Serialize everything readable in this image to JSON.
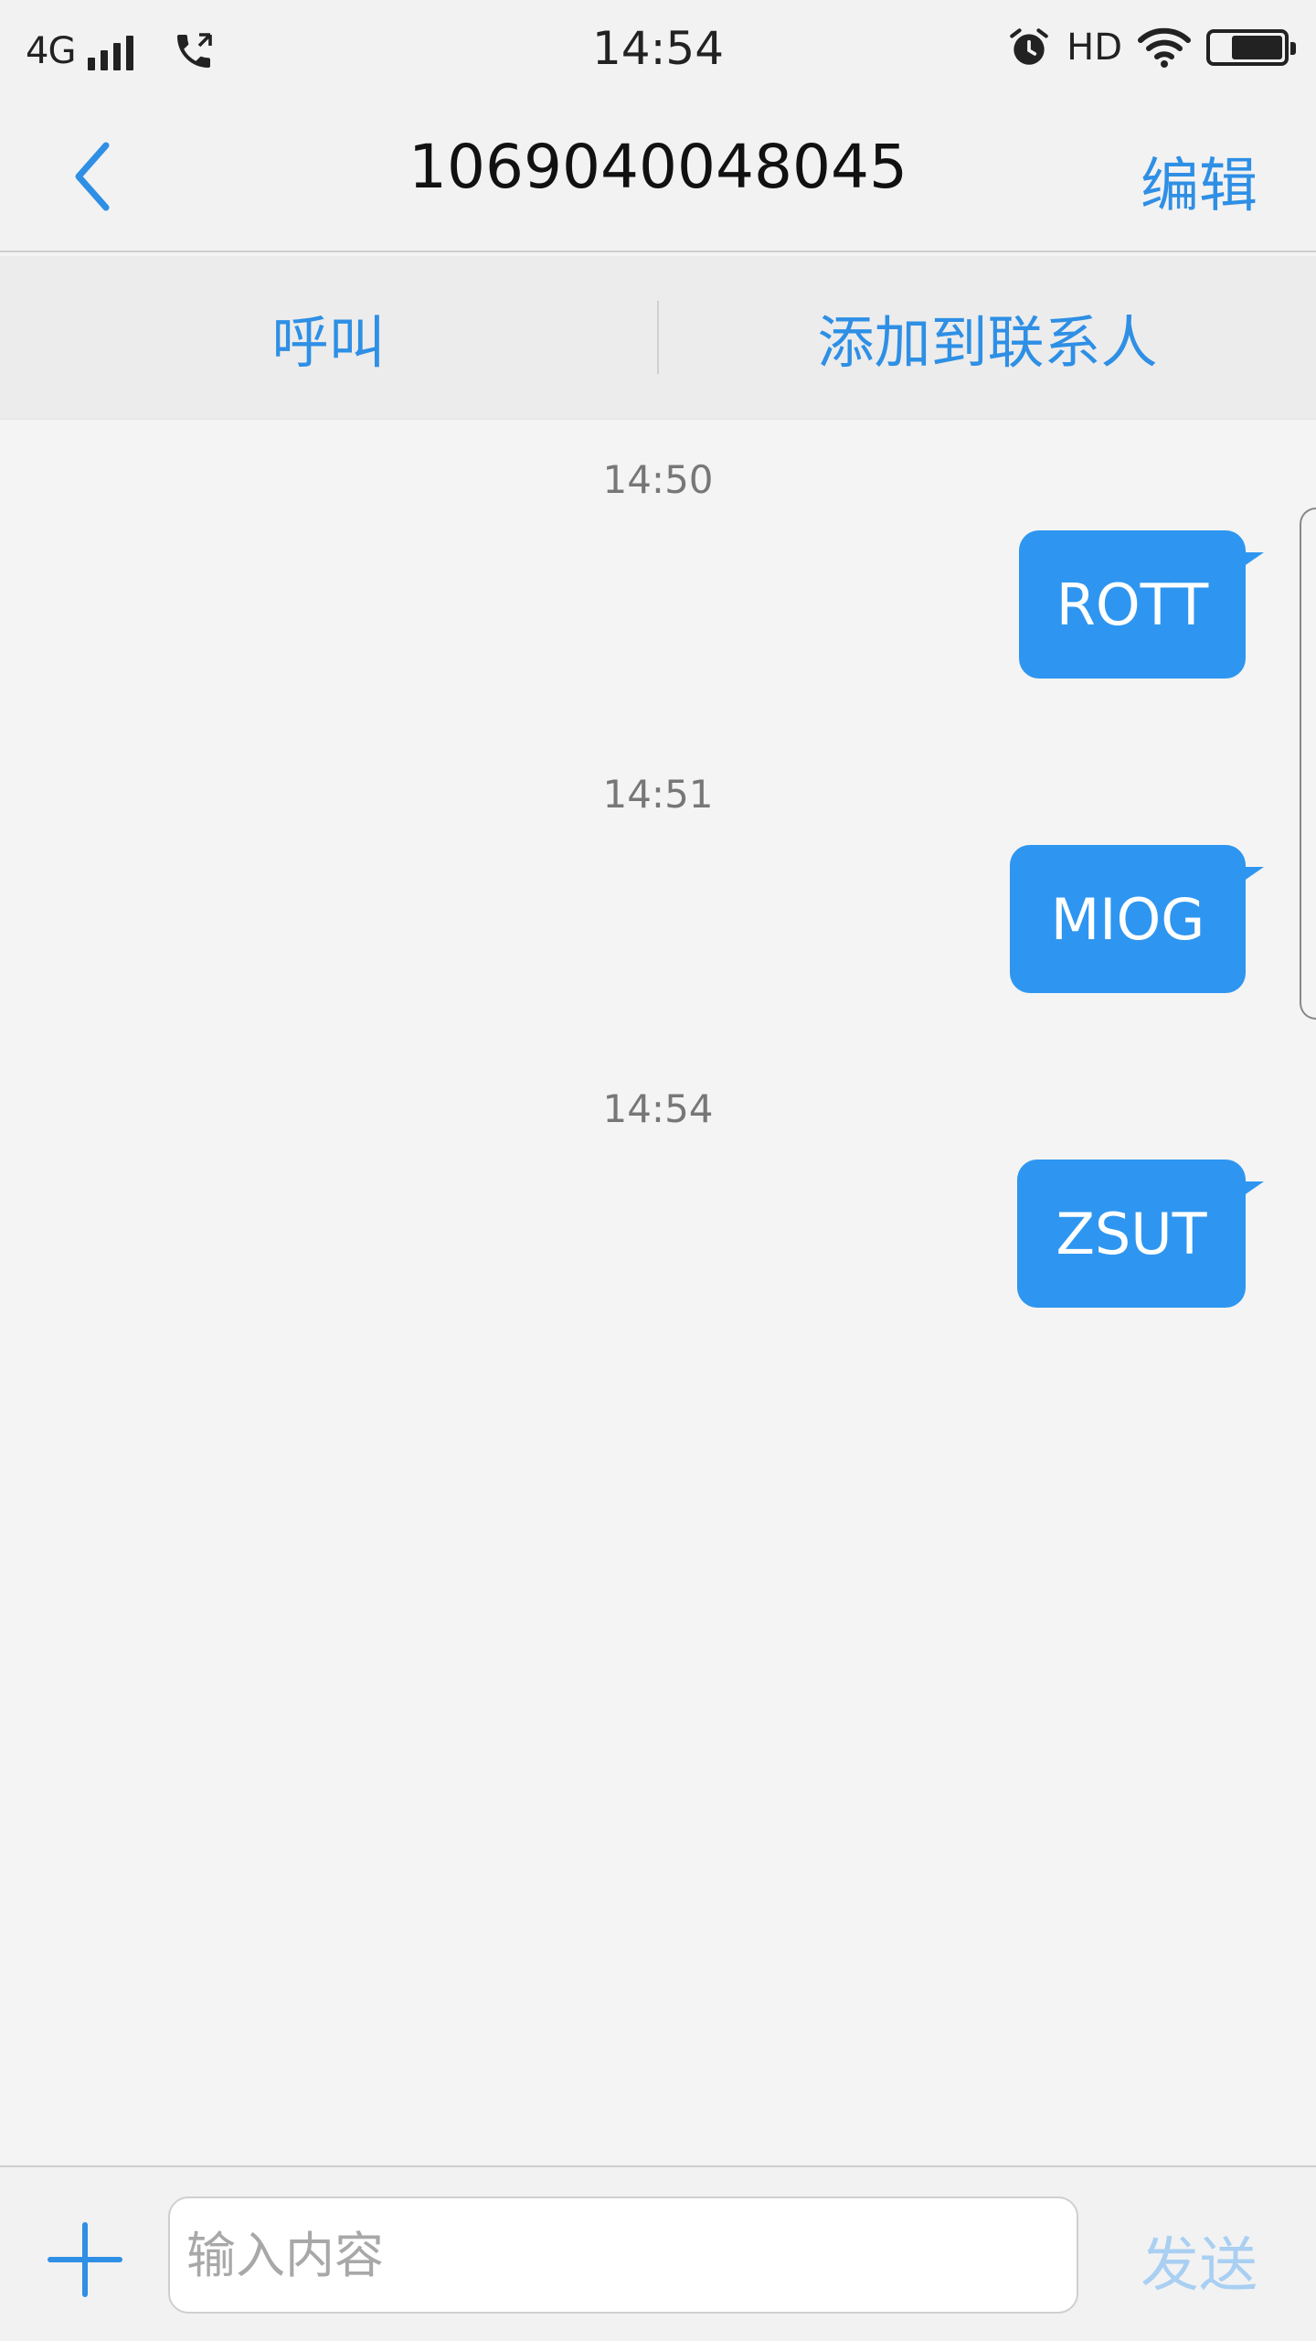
{
  "status_bar": {
    "network": "4G",
    "time": "14:54",
    "hd": "HD",
    "icons": [
      "signal-icon",
      "call-icon",
      "alarm-icon",
      "wifi-icon",
      "battery-icon"
    ]
  },
  "header": {
    "title": "1069040048045",
    "edit_label": "编辑",
    "back_icon": "chevron-left-icon"
  },
  "actions": {
    "call_label": "呼叫",
    "add_contact_label": "添加到联系人"
  },
  "messages": [
    {
      "time": "14:50",
      "text": "ROTT"
    },
    {
      "time": "14:51",
      "text": "MIOG"
    },
    {
      "time": "14:54",
      "text": "ZSUT"
    }
  ],
  "composer": {
    "placeholder": "输入内容",
    "send_label": "发送",
    "add_icon": "plus-icon"
  },
  "colors": {
    "accent": "#2e8fe5",
    "bubble": "#2e96f0",
    "send_disabled": "#a9cff2"
  }
}
